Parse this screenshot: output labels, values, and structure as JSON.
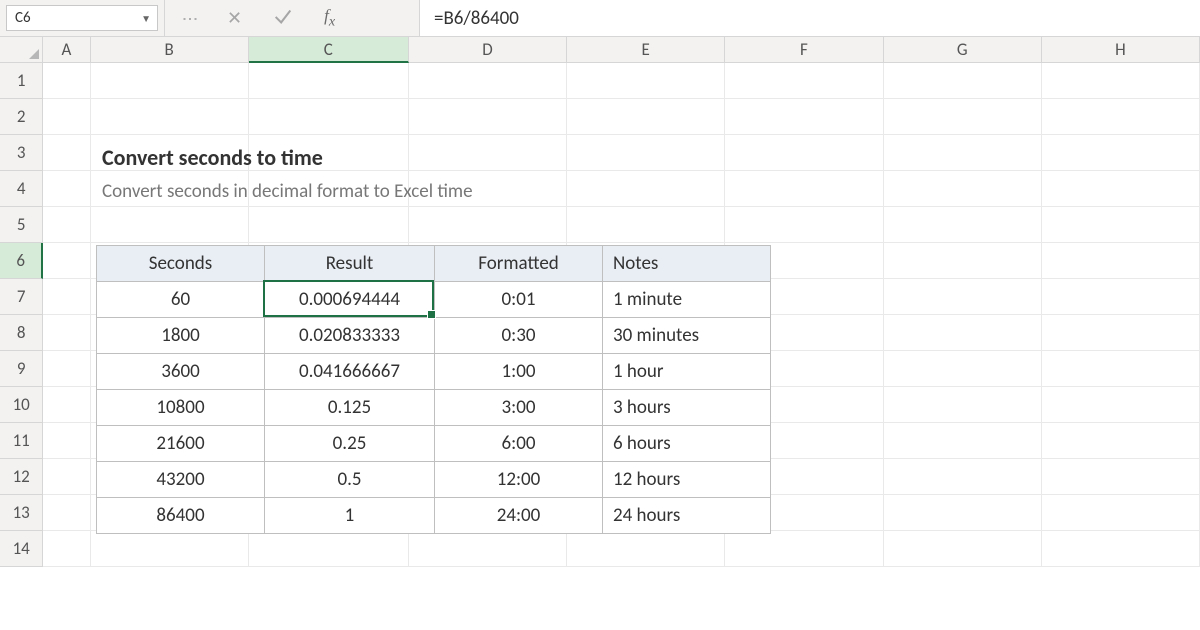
{
  "namebox": {
    "value": "C6"
  },
  "formula": "=B6/86400",
  "columns": [
    "A",
    "B",
    "C",
    "D",
    "E",
    "F",
    "G",
    "H"
  ],
  "active_col": "C",
  "rows": [
    "1",
    "2",
    "3",
    "4",
    "5",
    "6",
    "7",
    "8",
    "9",
    "10",
    "11",
    "12",
    "13",
    "14"
  ],
  "active_row": "6",
  "title": "Convert seconds to time",
  "subtitle": "Convert seconds in decimal format to Excel time",
  "headers": {
    "b": "Seconds",
    "c": "Result",
    "d": "Formatted",
    "e": "Notes"
  },
  "data": [
    {
      "seconds": "60",
      "result": "0.000694444",
      "formatted": "0:01",
      "notes": "1 minute"
    },
    {
      "seconds": "1800",
      "result": "0.020833333",
      "formatted": "0:30",
      "notes": "30 minutes"
    },
    {
      "seconds": "3600",
      "result": "0.041666667",
      "formatted": "1:00",
      "notes": "1 hour"
    },
    {
      "seconds": "10800",
      "result": "0.125",
      "formatted": "3:00",
      "notes": "3 hours"
    },
    {
      "seconds": "21600",
      "result": "0.25",
      "formatted": "6:00",
      "notes": "6 hours"
    },
    {
      "seconds": "43200",
      "result": "0.5",
      "formatted": "12:00",
      "notes": "12 hours"
    },
    {
      "seconds": "86400",
      "result": "1",
      "formatted": "24:00",
      "notes": "24 hours"
    }
  ]
}
